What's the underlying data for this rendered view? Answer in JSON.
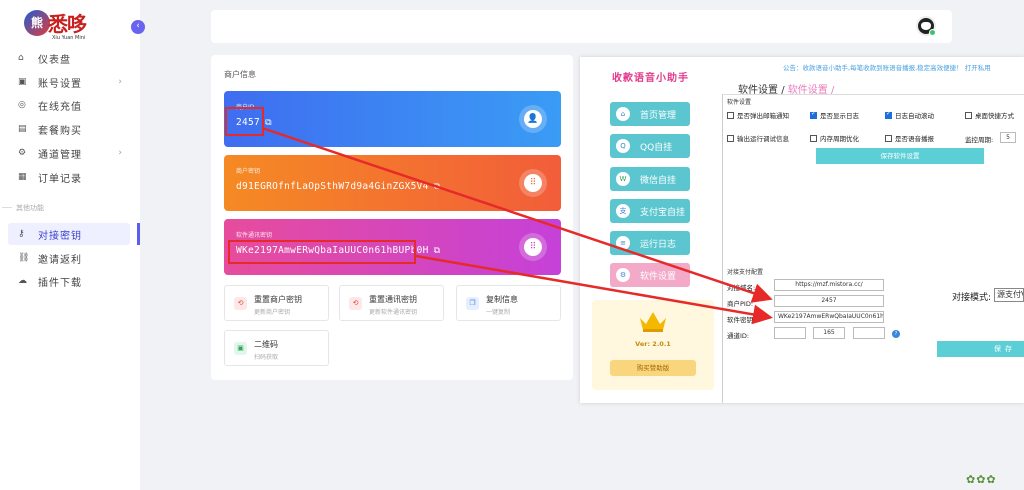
{
  "logo": {
    "mark": "熊",
    "text": "悉哆",
    "sub": "Xiu Yuan Mini"
  },
  "sidebar": {
    "items": [
      {
        "label": "仪表盘",
        "icon": "⌂"
      },
      {
        "label": "账号设置",
        "icon": "▣",
        "arrow": "›"
      },
      {
        "label": "在线充值",
        "icon": "◎"
      },
      {
        "label": "套餐购买",
        "icon": "▤"
      },
      {
        "label": "通道管理",
        "icon": "⚙",
        "arrow": "›"
      },
      {
        "label": "订单记录",
        "icon": "▦"
      }
    ],
    "group_label": "其他功能",
    "other_items": [
      {
        "label": "对接密钥",
        "icon": "⚷"
      },
      {
        "label": "邀请返利",
        "icon": "⛓"
      },
      {
        "label": "插件下载",
        "icon": "☁"
      }
    ]
  },
  "panel": {
    "title": "商户信息",
    "cards": [
      {
        "label": "商户ID",
        "value": "2457",
        "icon": "👤"
      },
      {
        "label": "商户密钥",
        "value": "d91EGROfnfLaOpSthW7d9a4GinZGX5V4",
        "icon": "⠿"
      },
      {
        "label": "软件通讯密钥",
        "value": "WKe2197AmwERwQbaIaUUC0n61hBUPb0H",
        "icon": "⠿"
      }
    ],
    "copy_icon": "⧉",
    "actions": [
      {
        "name": "重置商户密钥",
        "desc": "更新商户密钥",
        "icon": "⟲"
      },
      {
        "name": "重置通讯密钥",
        "desc": "更新软件通讯密钥",
        "icon": "⟲"
      },
      {
        "name": "复制信息",
        "desc": "一键复制",
        "icon": "❐"
      },
      {
        "name": "二维码",
        "desc": "扫码获取",
        "icon": "▣"
      }
    ]
  },
  "software": {
    "title": "收款语音小助手",
    "notice": "公告：收款语音小助手,每笔收款到账语音播报,稳定高效便捷！ 打开私用",
    "breadcrumb": [
      "软件设置",
      "/",
      "软件设置",
      "/"
    ],
    "menu": [
      {
        "label": "首页管理",
        "icon": "⌂"
      },
      {
        "label": "QQ自挂",
        "icon": "Q"
      },
      {
        "label": "微信自挂",
        "icon": "W"
      },
      {
        "label": "支付宝自挂",
        "icon": "支"
      },
      {
        "label": "运行日志",
        "icon": "≡"
      },
      {
        "label": "软件设置",
        "icon": "⚙"
      }
    ],
    "vip": {
      "version": "Ver: 2.0.1",
      "button": "购买赞助版"
    },
    "settings_title": "软件设置",
    "checkboxes": [
      {
        "label": "是否弹出邮箱通知",
        "checked": false
      },
      {
        "label": "是否显示日志",
        "checked": true
      },
      {
        "label": "日志自动滚动",
        "checked": true
      },
      {
        "label": "桌面快捷方式",
        "checked": false
      },
      {
        "label": "输出运行调试信息",
        "checked": false
      },
      {
        "label": "内存周期优化",
        "checked": false
      },
      {
        "label": "是否语音播报",
        "checked": false
      }
    ],
    "monitor_label": "监控周期:",
    "monitor_value": "5",
    "save_settings": "保存软件设置",
    "pay_title": "对接支付配置",
    "domain_label": "对接域名:",
    "domain_value": "https://mzf.mistora.cc/",
    "pid_label": "商户PID:",
    "pid_value": "2457",
    "key_label": "软件密钥:",
    "key_value": "WKe2197AmwERwQbaIaUUC0n61hBUPb0H",
    "channel_label": "通道ID:",
    "channel_value": "165",
    "mode_label": "对接模式:",
    "mode_value": "源支付V",
    "save_label": "保存",
    "help": "?"
  },
  "colors": {
    "accent": "#5b5cf0",
    "arrow": "#e62a2a"
  }
}
